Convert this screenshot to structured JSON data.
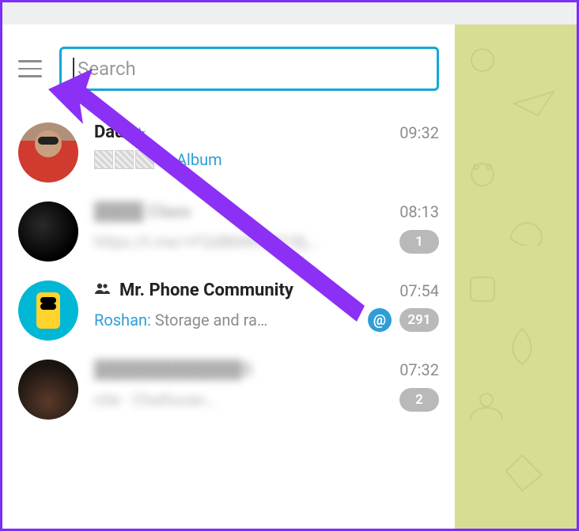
{
  "search": {
    "placeholder": "Search"
  },
  "chats": [
    {
      "name": "Dad",
      "verified": true,
      "time": "09:32",
      "preview_type": "album",
      "album_label": "Album"
    },
    {
      "name": "████ Class",
      "time": "08:13",
      "preview": "https://t.me/+FQdBbMOG91Bj…",
      "unread": "1",
      "blurred": true
    },
    {
      "name": "Mr. Phone Community",
      "is_group": true,
      "time": "07:54",
      "sender": "Roshan:",
      "preview": "Storage and ra…",
      "mention": true,
      "unread": "291"
    },
    {
      "name": "████████████S",
      "time": "07:32",
      "preview": "ntle · Chathuran…",
      "unread": "2",
      "blurred": true
    }
  ]
}
